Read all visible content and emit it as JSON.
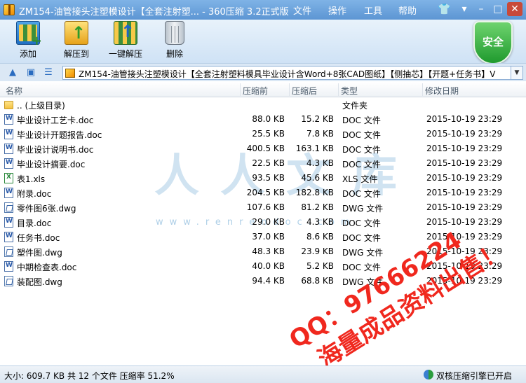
{
  "window": {
    "title": "ZM154-油管接头注塑模设计【全套注射塑... - 360压缩 3.2正式版",
    "menu": [
      "文件",
      "操作",
      "工具",
      "帮助"
    ]
  },
  "toolbar": {
    "add_label": "添加",
    "extract_label": "解压到",
    "oneclick_label": "一键解压",
    "delete_label": "删除"
  },
  "security_badge": "安全",
  "address": {
    "path": "ZM154-油管接头注塑模设计【全套注射塑料模具毕业设计含Word+8张CAD图纸】【侧抽芯】【开题+任务书】V"
  },
  "columns": {
    "name": "名称",
    "packed": "压缩前",
    "unpacked": "压缩后",
    "type": "类型",
    "modified": "修改日期"
  },
  "files": [
    {
      "name": ".. (上级目录)",
      "before": "",
      "after": "",
      "type": "文件夹",
      "date": "",
      "icon": "folder-icon"
    },
    {
      "name": "毕业设计工艺卡.doc",
      "before": "88.0 KB",
      "after": "15.2 KB",
      "type": "DOC 文件",
      "date": "2015-10-19 23:29",
      "icon": "doc-file-icon"
    },
    {
      "name": "毕业设计开题报告.doc",
      "before": "25.5 KB",
      "after": "7.8 KB",
      "type": "DOC 文件",
      "date": "2015-10-19 23:29",
      "icon": "doc-file-icon"
    },
    {
      "name": "毕业设计说明书.doc",
      "before": "400.5 KB",
      "after": "163.1 KB",
      "type": "DOC 文件",
      "date": "2015-10-19 23:29",
      "icon": "doc-file-icon"
    },
    {
      "name": "毕业设计摘要.doc",
      "before": "22.5 KB",
      "after": "4.3 KB",
      "type": "DOC 文件",
      "date": "2015-10-19 23:29",
      "icon": "doc-file-icon"
    },
    {
      "name": "表1.xls",
      "before": "93.5 KB",
      "after": "45.6 KB",
      "type": "XLS 文件",
      "date": "2015-10-19 23:29",
      "icon": "xls-file-icon"
    },
    {
      "name": "附录.doc",
      "before": "204.5 KB",
      "after": "182.8 KB",
      "type": "DOC 文件",
      "date": "2015-10-19 23:29",
      "icon": "doc-file-icon"
    },
    {
      "name": "零件图6张.dwg",
      "before": "107.6 KB",
      "after": "81.2 KB",
      "type": "DWG 文件",
      "date": "2015-10-19 23:29",
      "icon": "dwg-file-icon"
    },
    {
      "name": "目录.doc",
      "before": "29.0 KB",
      "after": "4.3 KB",
      "type": "DOC 文件",
      "date": "2015-10-19 23:29",
      "icon": "doc-file-icon"
    },
    {
      "name": "任务书.doc",
      "before": "37.0 KB",
      "after": "8.6 KB",
      "type": "DOC 文件",
      "date": "2015-10-19 23:29",
      "icon": "doc-file-icon"
    },
    {
      "name": "塑件图.dwg",
      "before": "48.3 KB",
      "after": "23.9 KB",
      "type": "DWG 文件",
      "date": "2015-10-19 23:29",
      "icon": "dwg-file-icon"
    },
    {
      "name": "中期检查表.doc",
      "before": "40.0 KB",
      "after": "5.2 KB",
      "type": "DOC 文件",
      "date": "2015-10-19 23:29",
      "icon": "doc-file-icon"
    },
    {
      "name": "装配图.dwg",
      "before": "94.4 KB",
      "after": "68.8 KB",
      "type": "DWG 文件",
      "date": "2015-10-19 23:29",
      "icon": "dwg-file-icon"
    }
  ],
  "watermark": {
    "logo_text": "人人文库",
    "url": "www.renrendoc.com",
    "qq_line": "QQ：97666224",
    "promo_line": "海量成品资料出售！"
  },
  "status": {
    "summary": "大小: 609.7 KB 共 12 个文件 压缩率 51.2%",
    "engine": "双核压缩引擎已开启"
  }
}
